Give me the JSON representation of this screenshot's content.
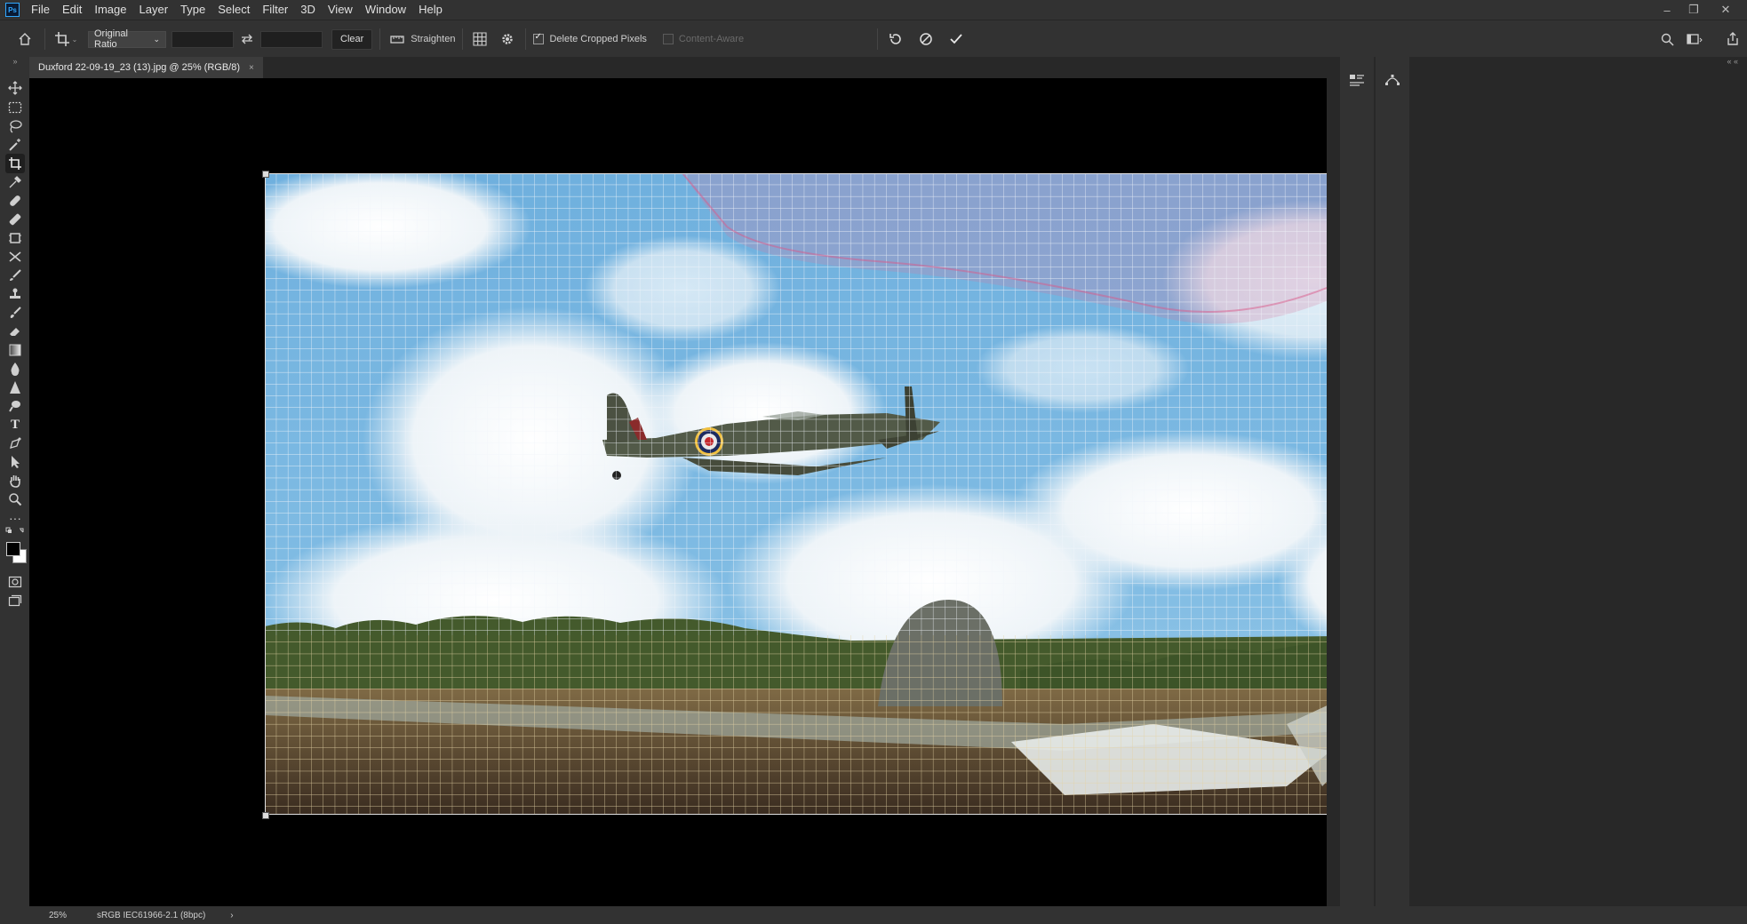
{
  "app": {
    "logo_text": "Ps"
  },
  "menu": [
    "File",
    "Edit",
    "Image",
    "Layer",
    "Type",
    "Select",
    "Filter",
    "3D",
    "View",
    "Window",
    "Help"
  ],
  "options": {
    "ratio_label": "Original Ratio",
    "clear_label": "Clear",
    "straighten_label": "Straighten",
    "delete_cropped_label": "Delete Cropped Pixels",
    "delete_cropped_checked": true,
    "content_aware_label": "Content-Aware",
    "content_aware_checked": false
  },
  "document": {
    "tab_title": "Duxford 22-09-19_23 (13).jpg @ 25% (RGB/8)",
    "close_glyph": "×"
  },
  "status": {
    "zoom": "25%",
    "profile": "sRGB IEC61966-2.1 (8bpc)",
    "arrow": "›"
  },
  "icons": {
    "home": "home-icon",
    "crop": "crop-tool-icon",
    "swap": "swap-icon",
    "straighten": "straighten-icon",
    "grid": "grid-overlay-icon",
    "settings": "gear-icon",
    "reset": "reset-icon",
    "cancel": "cancel-icon",
    "commit": "check-icon",
    "search": "search-icon",
    "workspace": "workspace-icon",
    "share": "share-icon"
  },
  "colors": {
    "grid_sky": "#eaf2f8",
    "grid_ground": "#d8c59a",
    "crop_accent": "#d95a8a"
  }
}
